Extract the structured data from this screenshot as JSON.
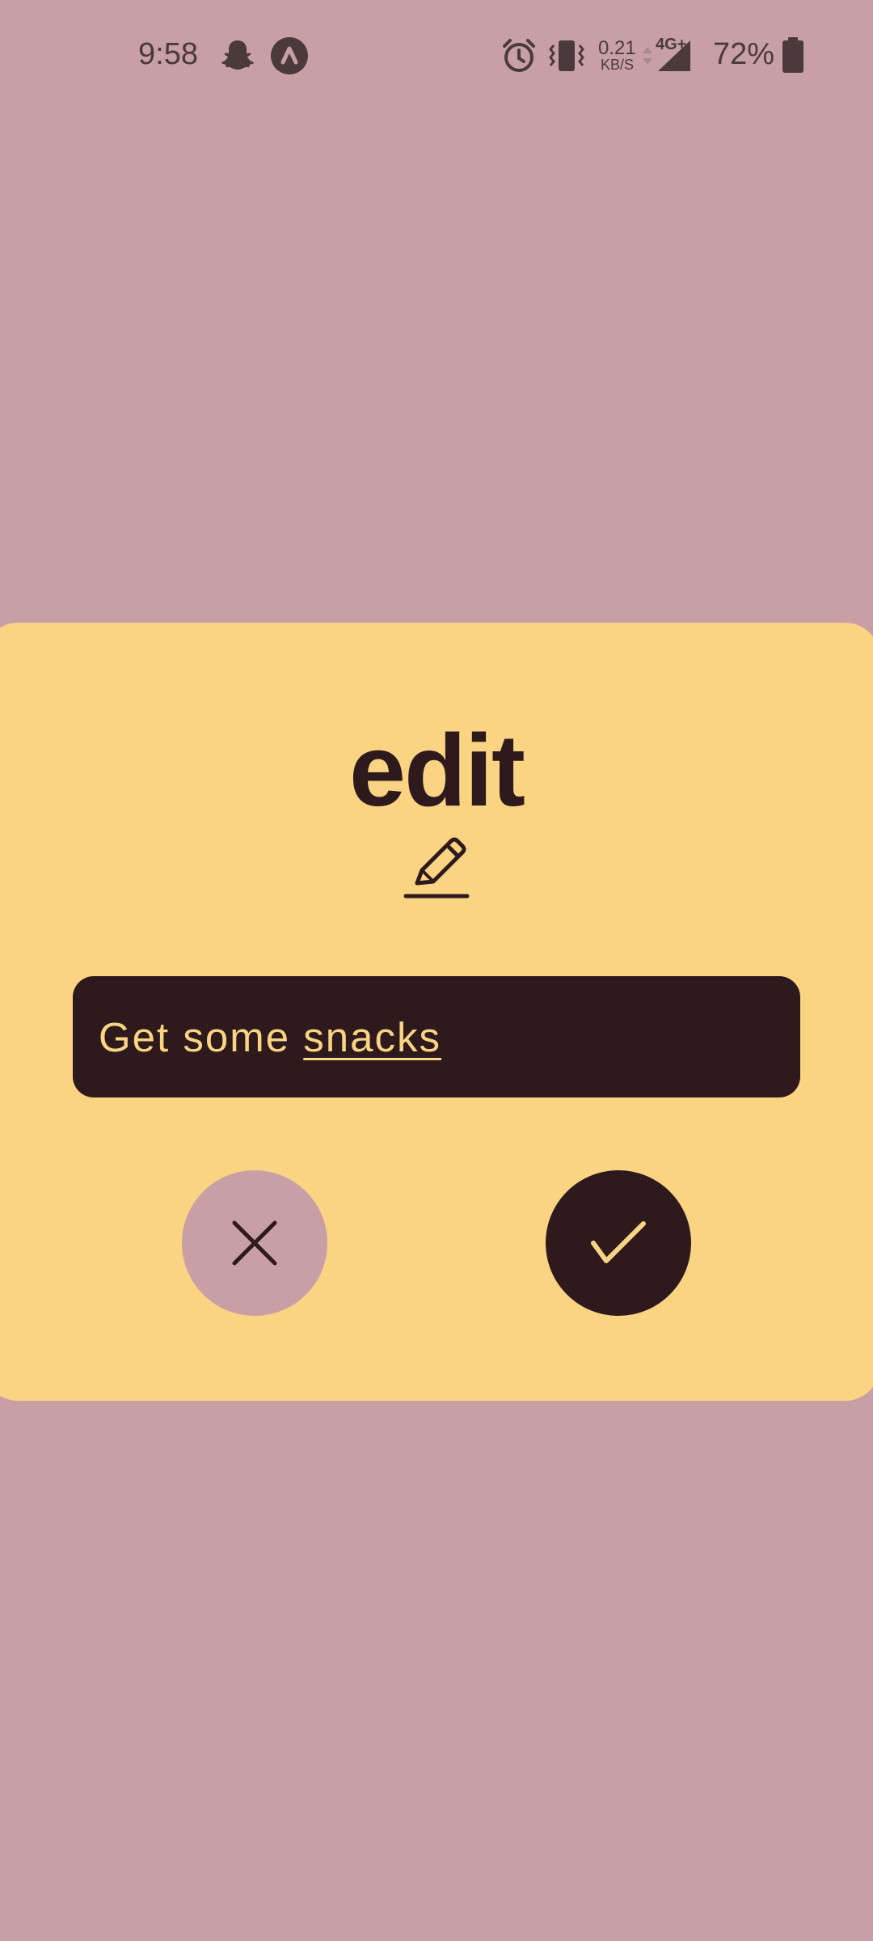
{
  "status_bar": {
    "time": "9:58",
    "net_speed_value": "0.21",
    "net_speed_unit": "KB/S",
    "network_type": "4G+",
    "battery": "72%",
    "icons": [
      "snapchat-icon",
      "app-notification-icon",
      "alarm-icon",
      "vibrate-icon",
      "data-arrows-icon",
      "signal-icon",
      "battery-icon"
    ]
  },
  "dialog": {
    "title": "edit",
    "title_icon": "pencil-edit-icon",
    "input": {
      "value_plain": "Get some ",
      "value_underlined": "snacks"
    },
    "cancel_icon": "close-icon",
    "confirm_icon": "check-icon"
  },
  "colors": {
    "background": "#C89FA5",
    "dialog": "#FAD483",
    "dark": "#2E1A1D",
    "status_icons": "#4a3a3c"
  }
}
